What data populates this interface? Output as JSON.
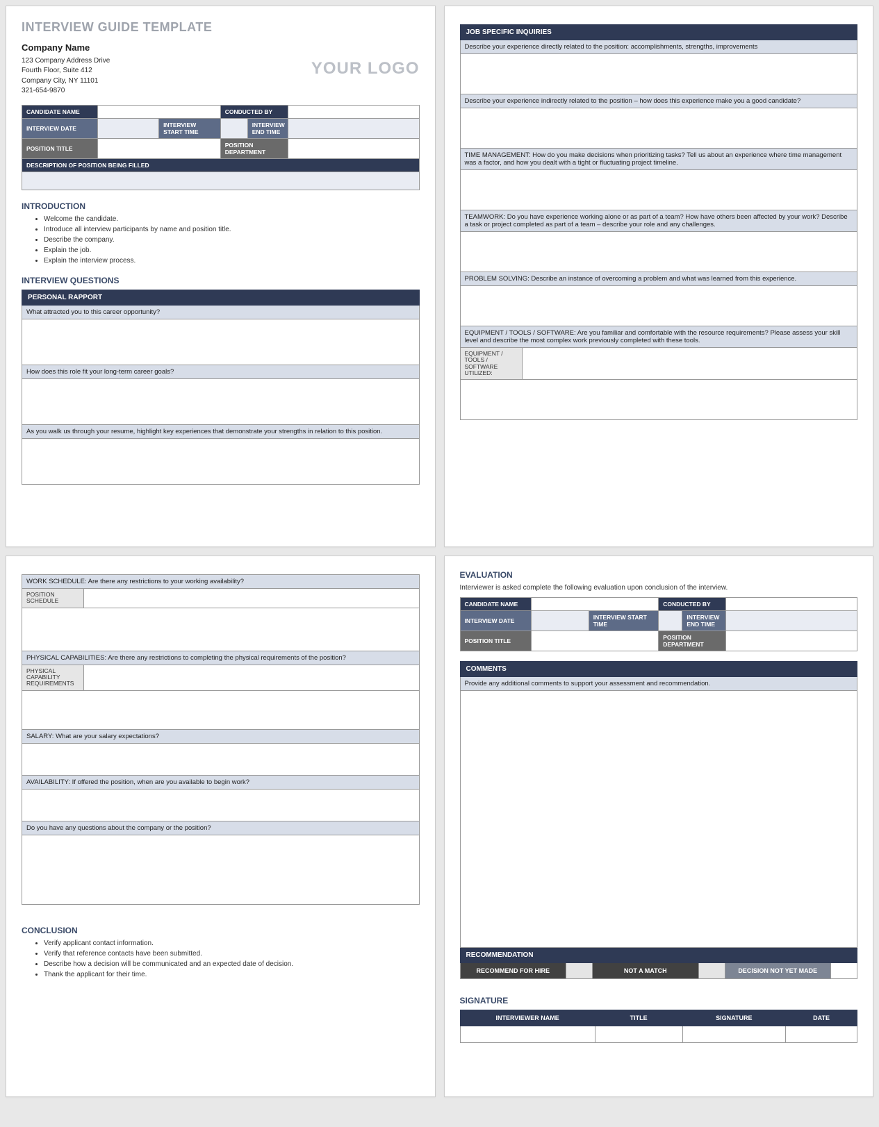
{
  "doc_title": "INTERVIEW GUIDE TEMPLATE",
  "company": {
    "name": "Company Name",
    "addr1": "123 Company Address Drive",
    "addr2": "Fourth Floor, Suite 412",
    "city": "Company City, NY  11101",
    "phone": "321-654-9870"
  },
  "logo_placeholder": "YOUR LOGO",
  "labels": {
    "candidate_name": "CANDIDATE NAME",
    "conducted_by": "CONDUCTED BY",
    "interview_date": "INTERVIEW DATE",
    "interview_start": "INTERVIEW START TIME",
    "interview_end": "INTERVIEW END TIME",
    "position_title": "POSITION TITLE",
    "position_dept": "POSITION DEPARTMENT",
    "desc_position": "DESCRIPTION OF POSITION BEING FILLED"
  },
  "sections": {
    "introduction": "INTRODUCTION",
    "interview_questions": "INTERVIEW QUESTIONS",
    "personal_rapport": "PERSONAL RAPPORT",
    "job_specific": "JOB SPECIFIC INQUIRIES",
    "conclusion": "CONCLUSION",
    "evaluation": "EVALUATION",
    "comments": "COMMENTS",
    "recommendation": "RECOMMENDATION",
    "signature": "SIGNATURE"
  },
  "intro_list": [
    "Welcome the candidate.",
    "Introduce all interview participants by name and position title.",
    "Describe the company.",
    "Explain the job.",
    "Explain the interview process."
  ],
  "rapport_q": [
    "What attracted you to this career opportunity?",
    "How does this role fit your long-term career goals?",
    "As you walk us through your resume, highlight key experiences that demonstrate your strengths in relation to this position."
  ],
  "job_q": [
    "Describe your experience directly related to the position: accomplishments, strengths, improvements",
    "Describe your experience indirectly related to the position – how does this experience make you a good candidate?",
    "TIME MANAGEMENT: How do you make decisions when prioritizing tasks? Tell us about an experience where time management was a factor, and how you dealt with a tight or fluctuating project timeline.",
    "TEAMWORK: Do you have experience working alone or as part of a team? How have others been affected by your work? Describe a task or project completed as part of a team – describe your role and any challenges.",
    "PROBLEM SOLVING: Describe an instance of overcoming a problem and what was learned from this experience.",
    "EQUIPMENT / TOOLS / SOFTWARE: Are you familiar and comfortable with the resource requirements? Please assess your skill level and describe the most complex work previously completed with these tools."
  ],
  "equip_label": "EQUIPMENT / TOOLS / SOFTWARE UTILIZED:",
  "page3_q": {
    "work_schedule": "WORK SCHEDULE: Are there any restrictions to your working availability?",
    "position_schedule_label": "POSITION SCHEDULE",
    "physical": "PHYSICAL CAPABILITIES: Are there any restrictions to completing the physical requirements of the position?",
    "physical_label": "PHYSICAL CAPABILITY REQUIREMENTS",
    "salary": "SALARY: What are your salary expectations?",
    "availability": "AVAILABILITY:  If offered the position, when are you available to begin work?",
    "any_questions": "Do you have any questions about the company or the position?"
  },
  "conclusion_list": [
    "Verify applicant contact information.",
    "Verify that reference contacts have been submitted.",
    "Describe how a decision will be communicated and an expected date of decision.",
    "Thank the applicant for their time."
  ],
  "evaluation_intro": "Interviewer is asked complete the following evaluation upon conclusion of the interview.",
  "comments_prompt": "Provide any additional comments to support your assessment and recommendation.",
  "reco": {
    "recommend": "RECOMMEND FOR HIRE",
    "not_match": "NOT A MATCH",
    "not_yet": "DECISION NOT YET MADE"
  },
  "sig_headers": [
    "INTERVIEWER NAME",
    "TITLE",
    "SIGNATURE",
    "DATE"
  ]
}
